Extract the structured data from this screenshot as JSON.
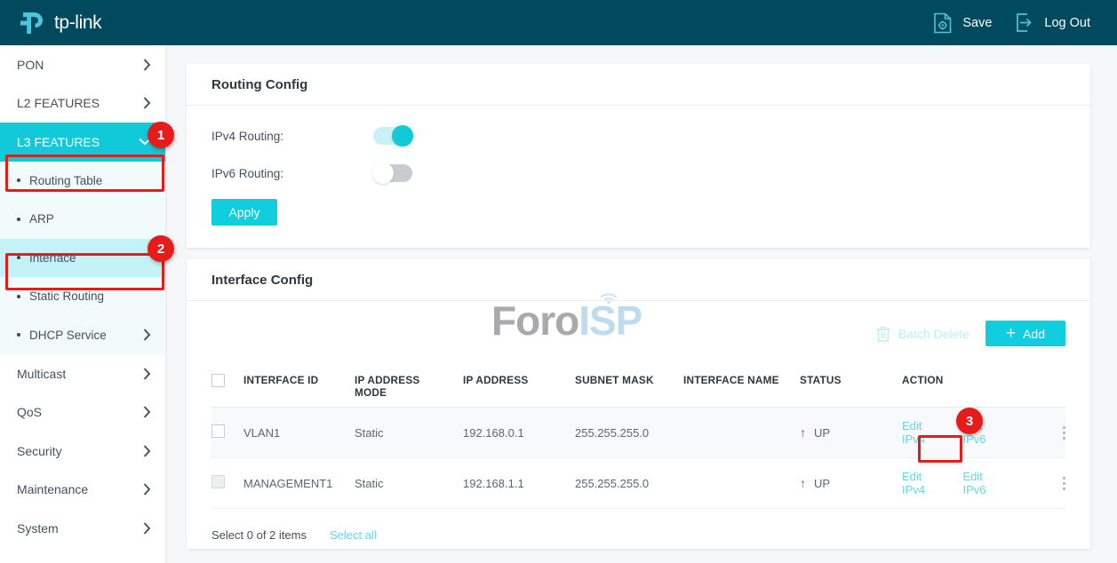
{
  "header": {
    "brand": "tp-link",
    "actions": [
      {
        "label": "Save",
        "icon": "save-gear-document-icon"
      },
      {
        "label": "Log Out",
        "icon": "logout-arrow-icon"
      }
    ]
  },
  "sidebar": {
    "items": [
      {
        "label": "PON",
        "type": "group",
        "expandable": true,
        "active": false
      },
      {
        "label": "L2 FEATURES",
        "type": "group",
        "expandable": true,
        "active": false
      },
      {
        "label": "L3 FEATURES",
        "type": "group",
        "expandable": true,
        "active": true
      },
      {
        "label": "Multicast",
        "type": "group",
        "expandable": true,
        "active": false
      },
      {
        "label": "QoS",
        "type": "group",
        "expandable": true,
        "active": false
      },
      {
        "label": "Security",
        "type": "group",
        "expandable": true,
        "active": false
      },
      {
        "label": "Maintenance",
        "type": "group",
        "expandable": true,
        "active": false
      },
      {
        "label": "System",
        "type": "group",
        "expandable": true,
        "active": false
      }
    ],
    "submenu": [
      {
        "label": "Routing Table",
        "expandable": false,
        "selected": false
      },
      {
        "label": "ARP",
        "expandable": false,
        "selected": false
      },
      {
        "label": "Interface",
        "expandable": false,
        "selected": true
      },
      {
        "label": "Static Routing",
        "expandable": false,
        "selected": false
      },
      {
        "label": "DHCP Service",
        "expandable": true,
        "selected": false
      }
    ]
  },
  "routing_config": {
    "title": "Routing Config",
    "ipv4_label": "IPv4 Routing:",
    "ipv4_state": "on",
    "ipv6_label": "IPv6 Routing:",
    "ipv6_state": "off",
    "apply_label": "Apply"
  },
  "interface_config": {
    "title": "Interface Config",
    "watermark": {
      "part1": "Foro",
      "part2": "ISP"
    },
    "batch_delete_label": "Batch Delete",
    "add_label": "Add",
    "columns": [
      "INTERFACE ID",
      "IP ADDRESS MODE",
      "IP ADDRESS",
      "SUBNET MASK",
      "INTERFACE NAME",
      "STATUS",
      "ACTION"
    ],
    "rows": [
      {
        "checked": false,
        "checkbox_disabled": false,
        "interface_id": "VLAN1",
        "ip_address_mode": "Static",
        "ip_address": "192.168.0.1",
        "subnet_mask": "255.255.255.0",
        "interface_name": "",
        "status": "UP",
        "action_ipv4": "Edit IPv4",
        "action_ipv6": "Edit IPv6"
      },
      {
        "checked": false,
        "checkbox_disabled": true,
        "interface_id": "MANAGEMENT1",
        "ip_address_mode": "Static",
        "ip_address": "192.168.1.1",
        "subnet_mask": "255.255.255.0",
        "interface_name": "",
        "status": "UP",
        "action_ipv4": "Edit IPv4",
        "action_ipv6": "Edit IPv6"
      }
    ],
    "select_summary": "Select 0 of 2 items",
    "select_all_label": "Select all"
  },
  "annotations": [
    {
      "number": "1",
      "target": "L3 FEATURES sidebar group"
    },
    {
      "number": "2",
      "target": "Interface submenu item"
    },
    {
      "number": "3",
      "target": "Edit IPv4 link on MANAGEMENT1 row"
    }
  ],
  "colors": {
    "header_bg": "#01495c",
    "accent": "#11cde0",
    "annotation_red": "#e81b1b",
    "status_arrow": "#c01ae6",
    "link": "#62d7e8"
  }
}
